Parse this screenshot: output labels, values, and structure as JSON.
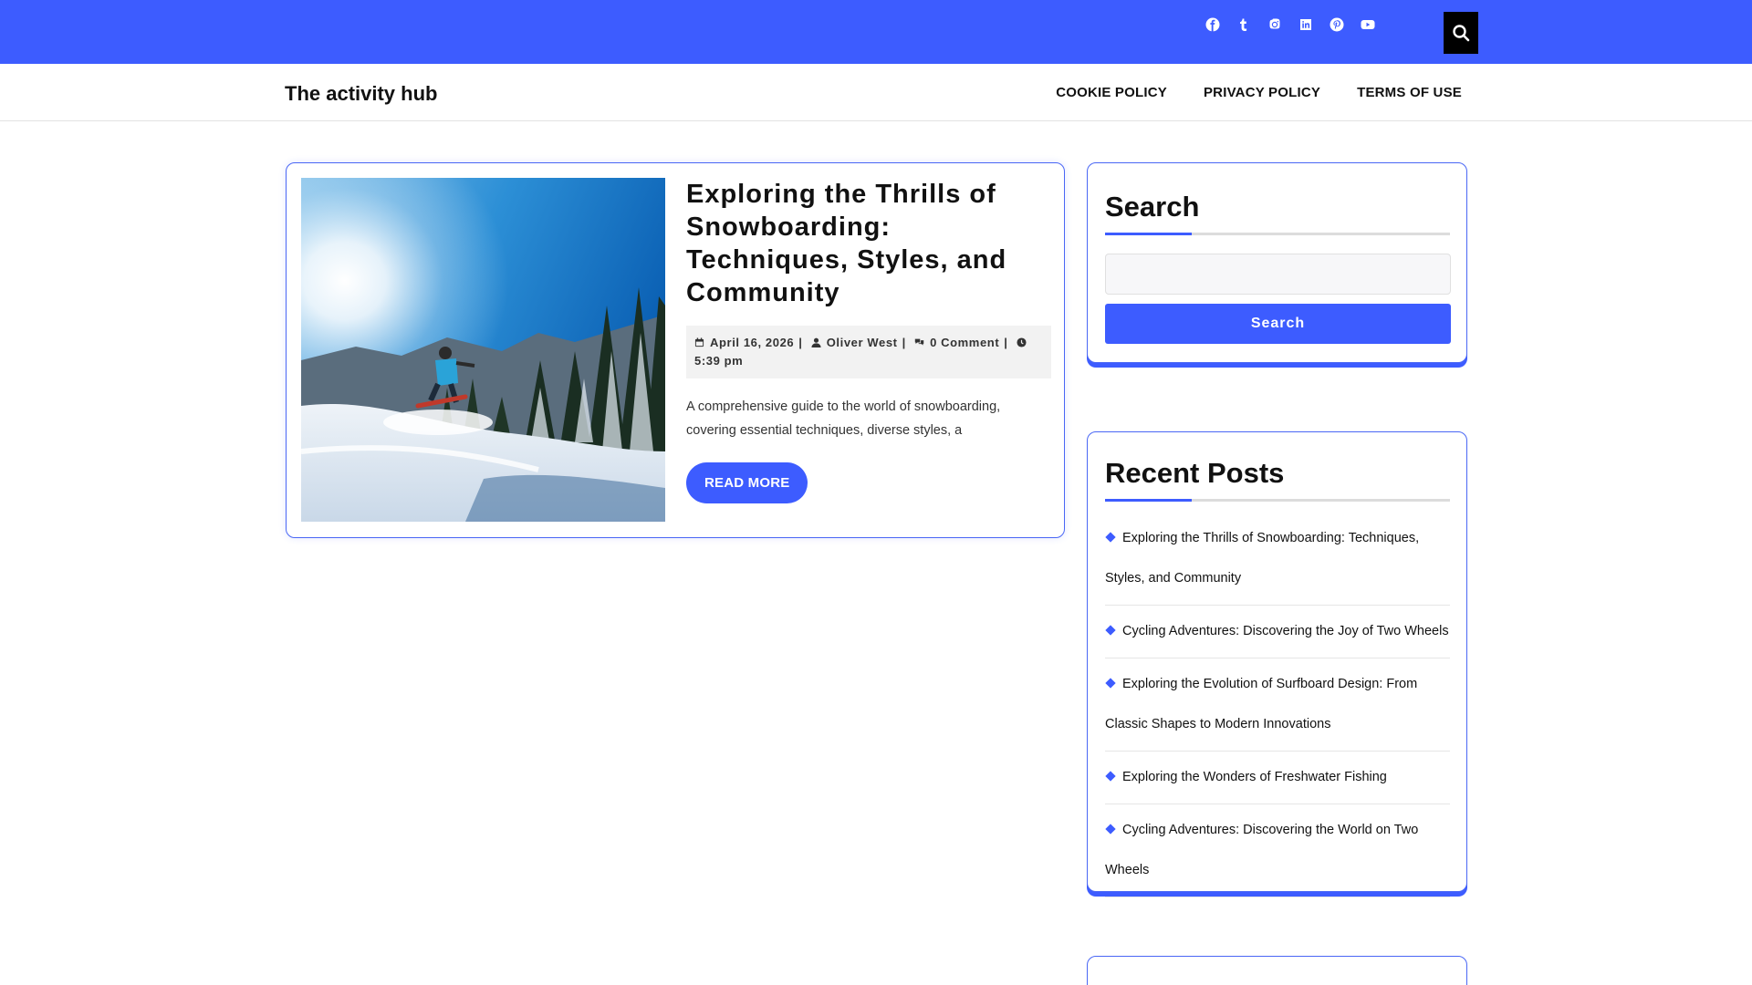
{
  "topbar": {
    "social_icons": [
      "facebook-icon",
      "tumblr-icon",
      "instagram-icon",
      "linkedin-icon",
      "pinterest-icon",
      "youtube-icon"
    ],
    "search_icon": "search-icon",
    "color": "#3d5cff"
  },
  "header": {
    "site_title": "The activity hub",
    "nav": [
      "COOKIE POLICY",
      "PRIVACY POLICY",
      "TERMS OF USE"
    ]
  },
  "post": {
    "title": "Exploring the Thrills of Snowboarding: Techniques, Styles, and Community",
    "date": "April 16, 2026",
    "author": "Oliver West",
    "comments": "0 Comment",
    "time": "5:39 pm",
    "excerpt": "A comprehensive guide to the world of snowboarding, covering essential techniques, diverse styles, a",
    "read_more": "READ MORE"
  },
  "sidebar": {
    "search_widget": {
      "title": "Search",
      "button": "Search"
    },
    "recent_widget": {
      "title": "Recent Posts",
      "items": [
        "Exploring the Thrills of Snowboarding: Techniques, Styles, and Community",
        "Cycling Adventures: Discovering the Joy of Two Wheels",
        "Exploring the Evolution of Surfboard Design: From Classic Shapes to Modern Innovations",
        "Exploring the Wonders of Freshwater Fishing",
        "Cycling Adventures: Discovering the World on Two Wheels"
      ]
    }
  }
}
